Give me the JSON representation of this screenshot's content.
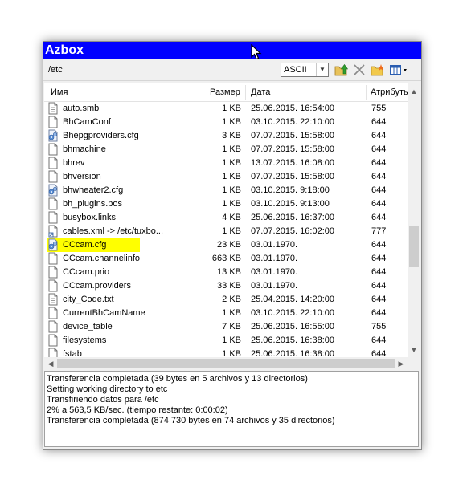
{
  "window": {
    "title": "Azbox"
  },
  "toolbar": {
    "path": "/etc",
    "transfer_mode": "ASCII",
    "buttons": [
      "up-folder-icon",
      "delete-x-icon",
      "new-folder-icon",
      "view-mode-icon"
    ]
  },
  "columns": {
    "name": "Имя",
    "size": "Размер",
    "date": "Дата",
    "attributes": "Атрибуты"
  },
  "files": [
    {
      "name": "auto.smb",
      "size": "1 KB",
      "date": "25.06.2015. 16:54:00",
      "attr": "755",
      "icon": "text-file-icon"
    },
    {
      "name": "BhCamConf",
      "size": "1 KB",
      "date": "03.10.2015. 22:10:00",
      "attr": "644",
      "icon": "file-icon"
    },
    {
      "name": "Bhepgproviders.cfg",
      "size": "3 KB",
      "date": "07.07.2015. 15:58:00",
      "attr": "644",
      "icon": "config-file-icon"
    },
    {
      "name": "bhmachine",
      "size": "1 KB",
      "date": "07.07.2015. 15:58:00",
      "attr": "644",
      "icon": "file-icon"
    },
    {
      "name": "bhrev",
      "size": "1 KB",
      "date": "13.07.2015. 16:08:00",
      "attr": "644",
      "icon": "file-icon"
    },
    {
      "name": "bhversion",
      "size": "1 KB",
      "date": "07.07.2015. 15:58:00",
      "attr": "644",
      "icon": "file-icon"
    },
    {
      "name": "bhwheater2.cfg",
      "size": "1 KB",
      "date": "03.10.2015. 9:18:00",
      "attr": "644",
      "icon": "config-file-icon"
    },
    {
      "name": "bh_plugins.pos",
      "size": "1 KB",
      "date": "03.10.2015. 9:13:00",
      "attr": "644",
      "icon": "file-icon"
    },
    {
      "name": "busybox.links",
      "size": "4 KB",
      "date": "25.06.2015. 16:37:00",
      "attr": "644",
      "icon": "file-icon"
    },
    {
      "name": "cables.xml -> /etc/tuxbo...",
      "size": "1 KB",
      "date": "07.07.2015. 16:02:00",
      "attr": "777",
      "icon": "link-file-icon"
    },
    {
      "name": "CCcam.cfg",
      "size": "23 KB",
      "date": "03.01.1970.",
      "attr": "644",
      "icon": "config-file-icon",
      "highlight": true
    },
    {
      "name": "CCcam.channelinfo",
      "size": "663 KB",
      "date": "03.01.1970.",
      "attr": "644",
      "icon": "file-icon"
    },
    {
      "name": "CCcam.prio",
      "size": "13 KB",
      "date": "03.01.1970.",
      "attr": "644",
      "icon": "file-icon"
    },
    {
      "name": "CCcam.providers",
      "size": "33 KB",
      "date": "03.01.1970.",
      "attr": "644",
      "icon": "file-icon"
    },
    {
      "name": "city_Code.txt",
      "size": "2 KB",
      "date": "25.04.2015. 14:20:00",
      "attr": "644",
      "icon": "text-file-icon"
    },
    {
      "name": "CurrentBhCamName",
      "size": "1 KB",
      "date": "03.10.2015. 22:10:00",
      "attr": "644",
      "icon": "file-icon"
    },
    {
      "name": "device_table",
      "size": "7 KB",
      "date": "25.06.2015. 16:55:00",
      "attr": "755",
      "icon": "file-icon"
    },
    {
      "name": "filesystems",
      "size": "1 KB",
      "date": "25.06.2015. 16:38:00",
      "attr": "644",
      "icon": "file-icon"
    },
    {
      "name": "fstab",
      "size": "1 KB",
      "date": "25.06.2015. 16:38:00",
      "attr": "644",
      "icon": "file-icon"
    }
  ],
  "log": [
    "Transferencia completada (39 bytes en 5 archivos y 13 directorios)",
    "Setting working directory to etc",
    "Transfiriendo datos para /etc",
    "2% a 563,5 KB/sec. (tiempo restante: 0:00:02)",
    "Transferencia completada (874 730 bytes en 74 archivos y 35 directorios)"
  ],
  "colors": {
    "titlebar": "#0000ff",
    "highlight": "#ffff00"
  }
}
